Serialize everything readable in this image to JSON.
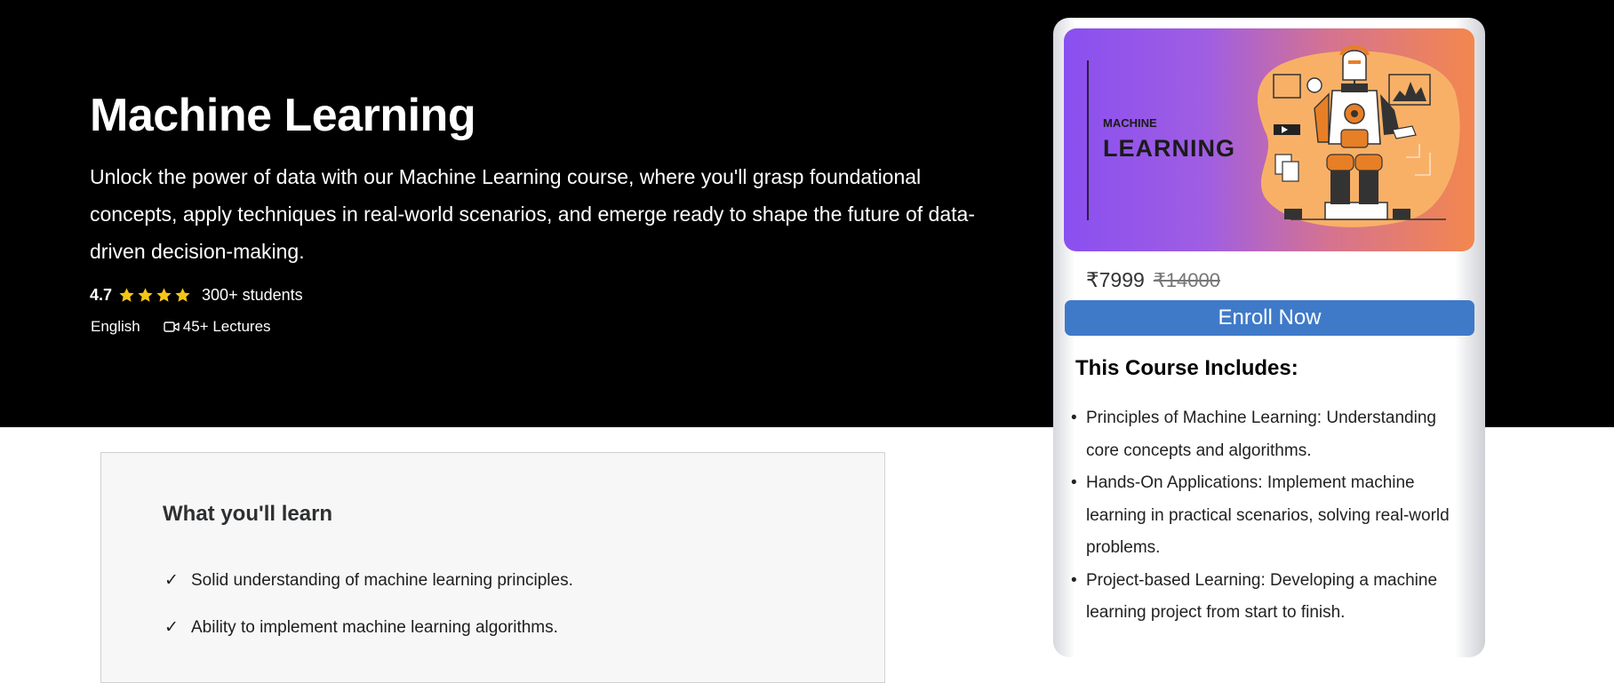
{
  "course": {
    "title": "Machine Learning",
    "description": "Unlock the power of data with our Machine Learning course, where you'll grasp foundational concepts, apply techniques in real-world scenarios, and emerge ready to shape the future of data-driven decision-making.",
    "rating": "4.7",
    "rating_stars": 4,
    "students": "300+ students",
    "language": "English",
    "lectures": "45+ Lectures"
  },
  "learn": {
    "title": "What you'll learn",
    "check_symbol": "✓",
    "items": [
      "Solid understanding of machine learning principles.",
      "Ability to implement machine learning algorithms."
    ]
  },
  "card": {
    "banner_small": "MACHINE",
    "banner_big": "LEARNING",
    "price": "₹7999",
    "old_price": "₹14000",
    "enroll_label": "Enroll Now",
    "includes_title": "This Course Includes:",
    "includes": [
      "Principles of Machine Learning: Understanding core concepts and algorithms.",
      "Hands-On Applications: Implement machine learning in practical scenarios, solving real-world problems.",
      "Project-based Learning: Developing a machine learning project from start to finish."
    ]
  },
  "colors": {
    "hero_bg": "#000000",
    "star": "#f5c518",
    "enroll": "#3f7ac9"
  }
}
